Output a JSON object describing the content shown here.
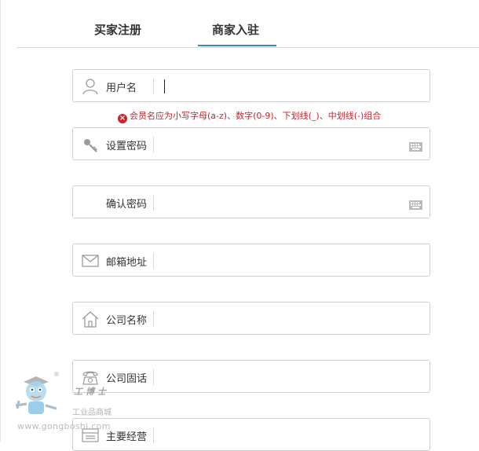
{
  "tabs": [
    {
      "label": "买家注册",
      "active": false
    },
    {
      "label": "商家入驻",
      "active": true
    }
  ],
  "accent_color": "#3a8bb0",
  "fields": {
    "username": {
      "label": "用户名",
      "icon": "user-icon",
      "value": ""
    },
    "password": {
      "label": "设置密码",
      "icon": "key-icon",
      "value": ""
    },
    "confirm_password": {
      "label": "确认密码",
      "value": ""
    },
    "email": {
      "label": "邮箱地址",
      "icon": "envelope-icon",
      "value": ""
    },
    "company_name": {
      "label": "公司名称",
      "icon": "house-icon",
      "value": ""
    },
    "company_phone": {
      "label": "公司固话",
      "icon": "phone-icon",
      "value": ""
    },
    "main_business": {
      "label": "主要经营",
      "icon": "list-icon",
      "value": ""
    }
  },
  "error": {
    "username": "会员名应为小写字母(a-z)、数字(0-9)、下划线(_)、中划线(-)组合",
    "color": "#d0212a"
  },
  "watermark": {
    "brand": "工博士",
    "tagline": "工业品商城",
    "url": "www.gongboshi.com",
    "registered": "®"
  }
}
